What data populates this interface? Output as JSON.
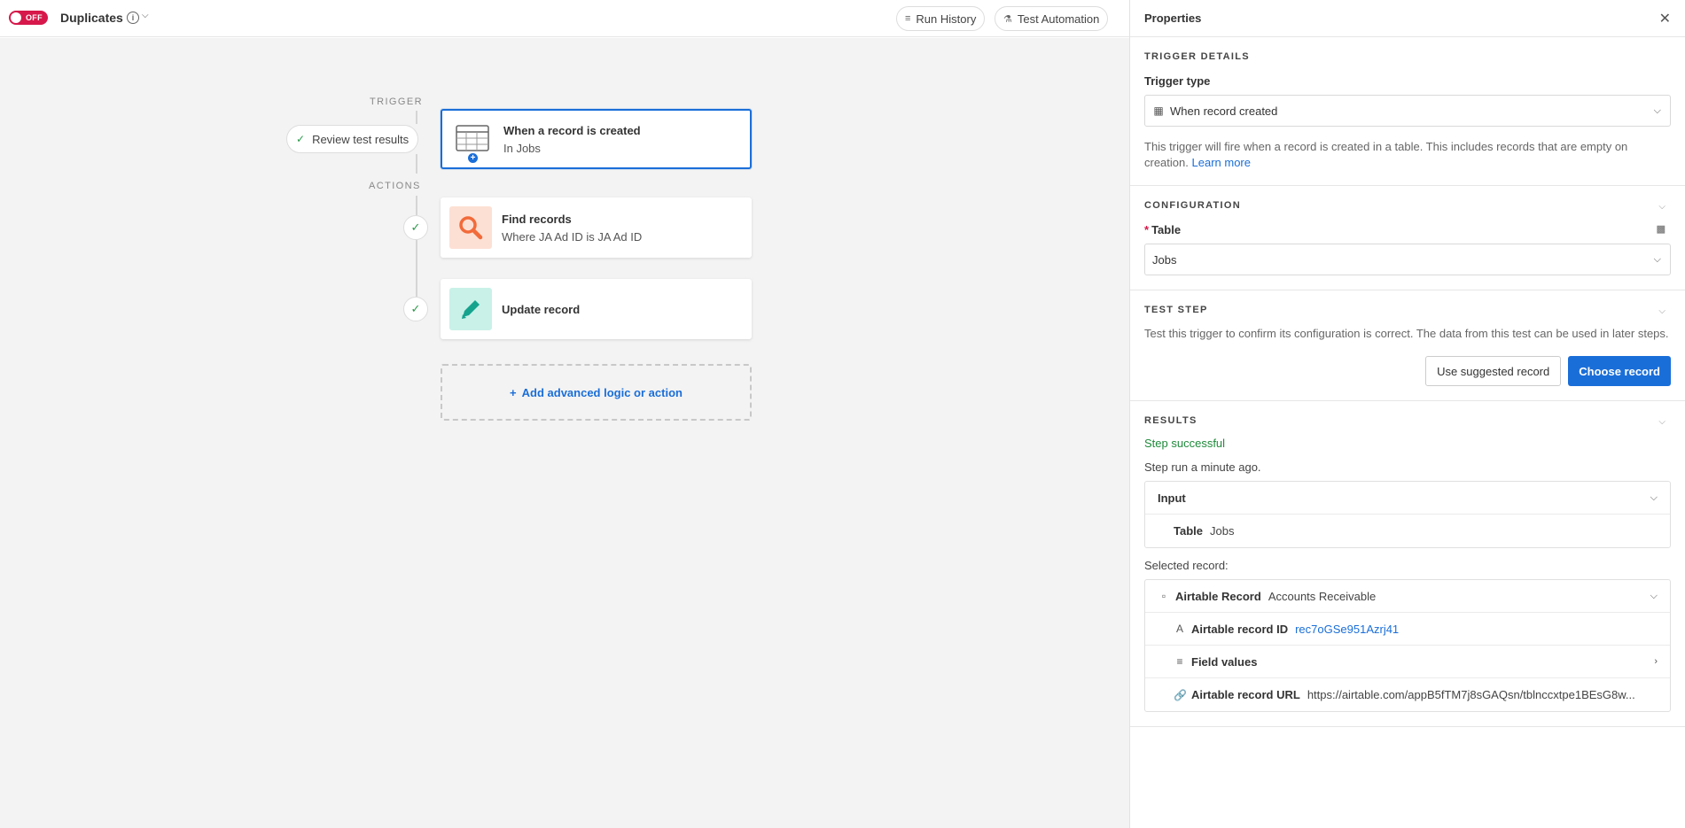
{
  "header": {
    "toggle_label": "OFF",
    "automation_name": "Duplicates",
    "run_history": "Run History",
    "test_automation": "Test Automation"
  },
  "canvas": {
    "trigger_label": "TRIGGER",
    "actions_label": "ACTIONS",
    "review_label": "Review test results",
    "trigger_card": {
      "title": "When a record is created",
      "sub": "In Jobs"
    },
    "actions": [
      {
        "title": "Find records",
        "sub": "Where JA Ad ID is JA Ad ID",
        "icon": "search-icon",
        "color": "#f26b3a"
      },
      {
        "title": "Update record",
        "sub": "",
        "icon": "pencil-icon",
        "color": "#15a38e"
      }
    ],
    "add_label": "Add advanced logic or action"
  },
  "panel": {
    "title": "Properties",
    "trigger_details": {
      "heading": "TRIGGER DETAILS",
      "type_label": "Trigger type",
      "type_value": "When record created",
      "description": "This trigger will fire when a record is created in a table. This includes records that are empty on creation.",
      "learn_more": "Learn more"
    },
    "configuration": {
      "heading": "CONFIGURATION",
      "table_label": "Table",
      "table_value": "Jobs"
    },
    "test_step": {
      "heading": "TEST STEP",
      "description": "Test this trigger to confirm its configuration is correct. The data from this test can be used in later steps.",
      "suggested": "Use suggested record",
      "choose": "Choose record"
    },
    "results": {
      "heading": "RESULTS",
      "status": "Step successful",
      "ran": "Step run a minute ago.",
      "input_label": "Input",
      "input_table_key": "Table",
      "input_table_val": "Jobs",
      "selected_label": "Selected record:",
      "record_type": "Airtable Record",
      "record_name": "Accounts Receivable",
      "record_id_key": "Airtable record ID",
      "record_id_val": "rec7oGSe951Azrj41",
      "field_values": "Field values",
      "record_url_key": "Airtable record URL",
      "record_url_val": "https://airtable.com/appB5fTM7j8sGAQsn/tblnccxtpe1BEsG8w..."
    }
  },
  "colors": {
    "accent": "#1a6ed8",
    "off_toggle": "#d6184a",
    "success": "#1f8a3b"
  }
}
